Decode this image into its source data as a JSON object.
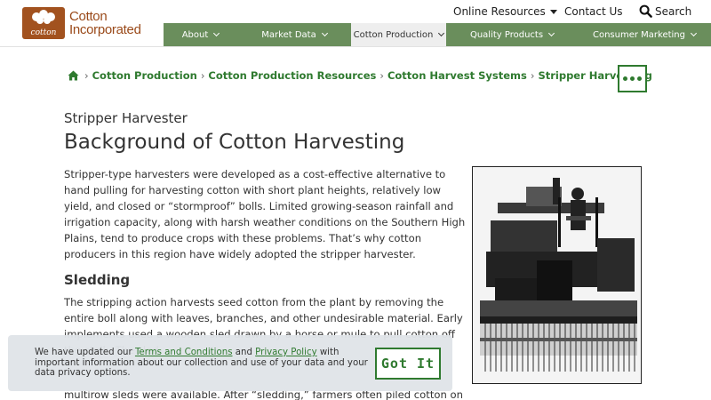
{
  "brand": {
    "name_line1": "Cotton",
    "name_line2": "Incorporated",
    "mark_text": "cotton",
    "accent": "#a2521f"
  },
  "utility_nav": {
    "online_resources": "Online Resources",
    "contact_us": "Contact Us",
    "search": "Search"
  },
  "main_nav": {
    "items": [
      {
        "label": "About"
      },
      {
        "label": "Market Data"
      },
      {
        "label": "Cotton Production"
      },
      {
        "label": "Quality Products"
      },
      {
        "label": "Consumer Marketing"
      }
    ],
    "active_index": 2,
    "color": "#6a8e5c"
  },
  "breadcrumb": {
    "items": [
      "Cotton Production",
      "Cotton Production Resources",
      "Cotton Harvest Systems",
      "Stripper Harvesting"
    ],
    "separator": "›",
    "link_color": "#2f7a2f"
  },
  "content": {
    "eyebrow": "Stripper Harvester",
    "title": "Background of Cotton Harvesting",
    "paragraph1": "Stripper-type harvesters were developed as a cost-effective alternative to hand pulling for harvesting cotton with short plant heights, relatively low yield, and closed or “stormproof” bolls. Limited growing-season rainfall and irrigation capacity, along with harsh weather conditions on the Southern High Plains, tend to produce crops with these problems. That’s why cotton producers in this region have widely adopted the stripper harvester.",
    "section_heading": "Sledding",
    "paragraph2": "The stripping action harvests seed cotton from the plant by removing the entire boll along with leaves, branches, and other undesirable material. Early implements used a wooden sled drawn by a horse or mule to pull cotton off the stalk. The sled",
    "paragraph3": "multirow sleds were available. After “sledding,” farmers often piled cotton on the"
  },
  "cookie_banner": {
    "text_before": "We have updated our ",
    "terms_link": "Terms and Conditions",
    "text_and": " and ",
    "privacy_link": "Privacy Policy",
    "text_after": " with important information about our collection and use of your data and your data privacy options.",
    "button": "Got It"
  }
}
